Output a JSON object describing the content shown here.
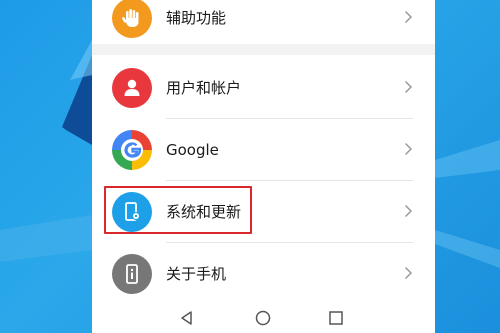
{
  "settings": {
    "items": [
      {
        "label": "辅助功能",
        "icon": "hand-icon",
        "color": "#f39a1e"
      },
      {
        "label": "用户和帐户",
        "icon": "user-icon",
        "color": "#e8383d"
      },
      {
        "label": "Google",
        "icon": "google-icon",
        "color": "#4285f4"
      },
      {
        "label": "系统和更新",
        "icon": "phone-gear-icon",
        "color": "#1ea0e8"
      },
      {
        "label": "关于手机",
        "icon": "info-phone-icon",
        "color": "#777777"
      }
    ],
    "highlighted_item": "系统和更新",
    "highlight_color": "#d8282c"
  },
  "navbar": {
    "buttons": [
      "back-button",
      "home-button",
      "recents-button"
    ]
  }
}
